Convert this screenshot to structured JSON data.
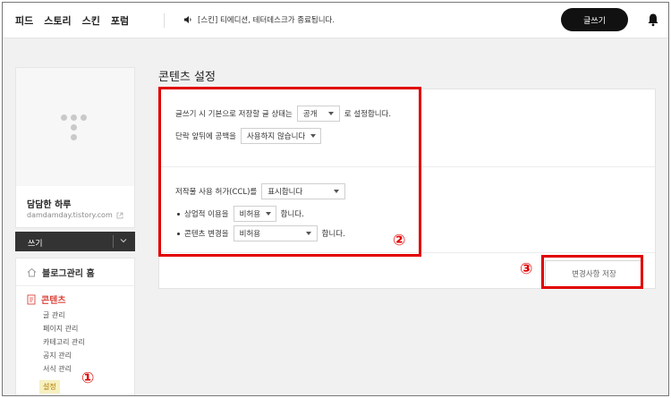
{
  "topbar": {
    "nav": [
      "피드",
      "스토리",
      "스킨",
      "포럼"
    ],
    "notice": "[스킨] 티에디션, 테터데스크가 종료됩니다.",
    "write_button": "글쓰기"
  },
  "sidebar": {
    "blog_name": "담담한 하루",
    "blog_url": "damdamday.tistory.com",
    "write_label": "쓰기",
    "home_label": "블로그관리 홈",
    "contents_label": "콘텐츠",
    "sub_items": [
      "글 관리",
      "페이지 관리",
      "카테고리 관리",
      "공지 관리",
      "서식 관리",
      "설정"
    ]
  },
  "main": {
    "title": "콘텐츠 설정",
    "row1_prefix": "글쓰기 시 기본으로 저장할 글 상태는",
    "row1_select": "공개",
    "row1_suffix": "로 설정합니다.",
    "row2_prefix": "단락 앞뒤에 공백을",
    "row2_select": "사용하지 않습니다",
    "row3_prefix": "저작물 사용 허가(CCL)를",
    "row3_select": "표시합니다",
    "row4_prefix": "상업적 이용을",
    "row4_select": "비허용",
    "row4_suffix": "합니다.",
    "row5_prefix": "콘텐츠 변경을",
    "row5_select": "비허용",
    "row5_suffix": "합니다.",
    "save_button": "변경사항 저장"
  },
  "annotations": {
    "one": "①",
    "two": "②",
    "three": "③",
    "color": "#e10000"
  }
}
